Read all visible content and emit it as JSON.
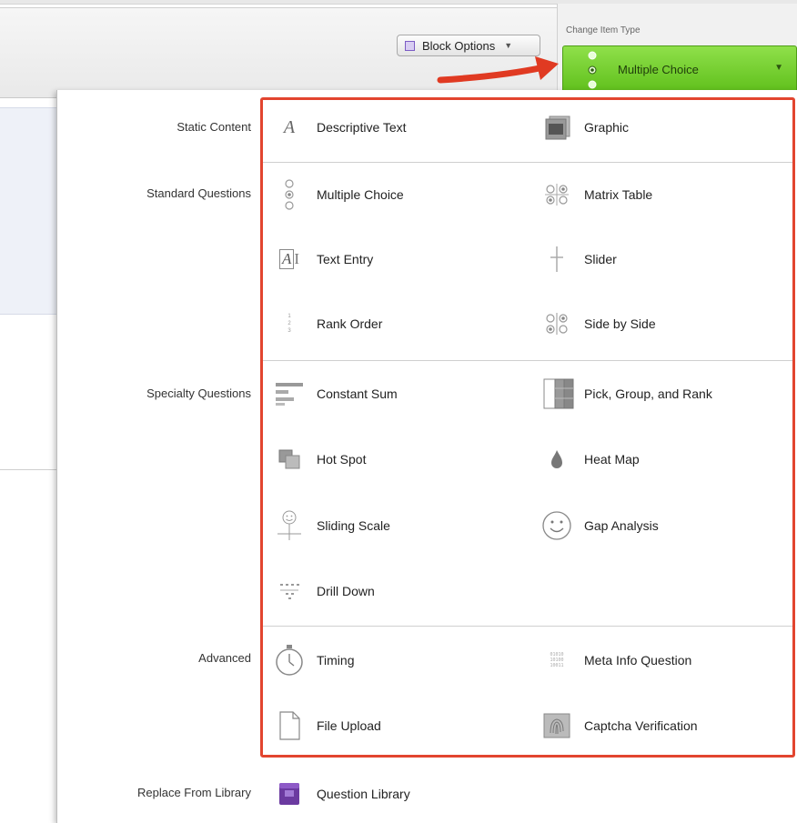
{
  "toolbar": {
    "block_options_label": "Block Options",
    "change_item_type_label": "Change Item Type",
    "current_type": "Multiple Choice"
  },
  "categories": {
    "static": "Static Content",
    "standard": "Standard Questions",
    "specialty": "Specialty Questions",
    "advanced": "Advanced",
    "library": "Replace From Library"
  },
  "items": {
    "descriptive_text": {
      "label": "Descriptive Text",
      "icon": "italic-a-icon"
    },
    "graphic": {
      "label": "Graphic",
      "icon": "image-stack-icon"
    },
    "multiple_choice": {
      "label": "Multiple Choice",
      "icon": "radio-list-icon"
    },
    "matrix_table": {
      "label": "Matrix Table",
      "icon": "radio-grid-icon"
    },
    "text_entry": {
      "label": "Text Entry",
      "icon": "text-cursor-icon"
    },
    "slider": {
      "label": "Slider",
      "icon": "slider-icon"
    },
    "rank_order": {
      "label": "Rank Order",
      "icon": "numbered-list-icon"
    },
    "side_by_side": {
      "label": "Side by Side",
      "icon": "radio-columns-icon"
    },
    "constant_sum": {
      "label": "Constant Sum",
      "icon": "bars-icon"
    },
    "pick_group_rank": {
      "label": "Pick, Group, and Rank",
      "icon": "groups-icon"
    },
    "hot_spot": {
      "label": "Hot Spot",
      "icon": "overlap-squares-icon"
    },
    "heat_map": {
      "label": "Heat Map",
      "icon": "flame-icon"
    },
    "sliding_scale": {
      "label": "Sliding Scale",
      "icon": "smiley-slider-icon"
    },
    "gap_analysis": {
      "label": "Gap Analysis",
      "icon": "smiley-icon"
    },
    "drill_down": {
      "label": "Drill Down",
      "icon": "tree-icon"
    },
    "timing": {
      "label": "Timing",
      "icon": "stopwatch-icon"
    },
    "meta_info": {
      "label": "Meta Info Question",
      "icon": "binary-icon"
    },
    "file_upload": {
      "label": "File Upload",
      "icon": "document-icon"
    },
    "captcha": {
      "label": "Captcha Verification",
      "icon": "fingerprint-icon"
    },
    "question_library": {
      "label": "Question Library",
      "icon": "library-icon"
    }
  },
  "colors": {
    "highlight_border": "#e2452f",
    "selected_type_bg": "#6cc928",
    "arrow": "#e03a22"
  }
}
